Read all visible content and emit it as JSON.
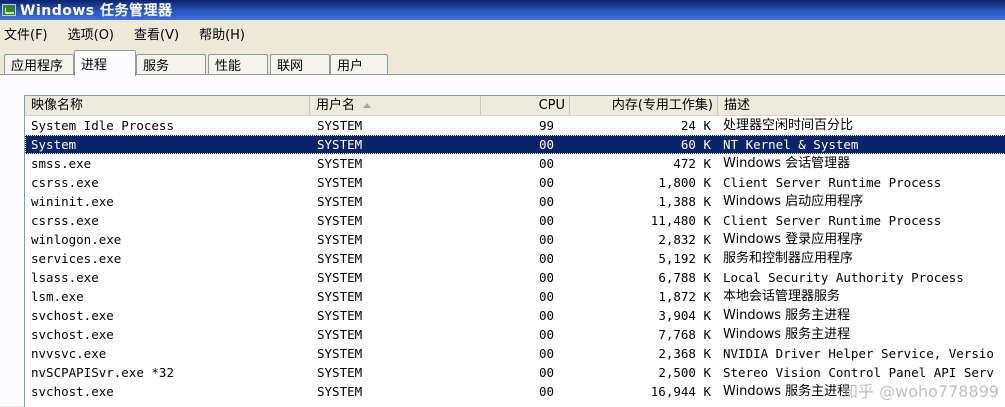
{
  "window": {
    "title": "Windows 任务管理器"
  },
  "menu": [
    "文件(F)",
    "选项(O)",
    "查看(V)",
    "帮助(H)"
  ],
  "tabs": [
    "应用程序",
    "进程",
    "服务",
    "性能",
    "联网",
    "用户"
  ],
  "active_tab": "进程",
  "columns": {
    "name": "映像名称",
    "user": "用户名",
    "cpu": "CPU",
    "mem": "内存(专用工作集)",
    "desc": "描述"
  },
  "rows": [
    {
      "name": "System Idle Process",
      "user": "SYSTEM",
      "cpu": "99",
      "mem": "24 K",
      "desc": "处理器空闲时间百分比"
    },
    {
      "name": "System",
      "user": "SYSTEM",
      "cpu": "00",
      "mem": "60 K",
      "desc": "NT Kernel & System",
      "selected": true
    },
    {
      "name": "smss.exe",
      "user": "SYSTEM",
      "cpu": "00",
      "mem": "472 K",
      "desc": "Windows 会话管理器"
    },
    {
      "name": "csrss.exe",
      "user": "SYSTEM",
      "cpu": "00",
      "mem": "1,800 K",
      "desc": "Client Server Runtime Process"
    },
    {
      "name": "wininit.exe",
      "user": "SYSTEM",
      "cpu": "00",
      "mem": "1,388 K",
      "desc": "Windows 启动应用程序"
    },
    {
      "name": "csrss.exe",
      "user": "SYSTEM",
      "cpu": "00",
      "mem": "11,480 K",
      "desc": "Client Server Runtime Process"
    },
    {
      "name": "winlogon.exe",
      "user": "SYSTEM",
      "cpu": "00",
      "mem": "2,832 K",
      "desc": "Windows 登录应用程序"
    },
    {
      "name": "services.exe",
      "user": "SYSTEM",
      "cpu": "00",
      "mem": "5,192 K",
      "desc": "服务和控制器应用程序"
    },
    {
      "name": "lsass.exe",
      "user": "SYSTEM",
      "cpu": "00",
      "mem": "6,788 K",
      "desc": "Local Security Authority Process"
    },
    {
      "name": "lsm.exe",
      "user": "SYSTEM",
      "cpu": "00",
      "mem": "1,872 K",
      "desc": "本地会话管理器服务"
    },
    {
      "name": "svchost.exe",
      "user": "SYSTEM",
      "cpu": "00",
      "mem": "3,904 K",
      "desc": "Windows 服务主进程"
    },
    {
      "name": "svchost.exe",
      "user": "SYSTEM",
      "cpu": "00",
      "mem": "7,768 K",
      "desc": "Windows 服务主进程"
    },
    {
      "name": "nvvsvc.exe",
      "user": "SYSTEM",
      "cpu": "00",
      "mem": "2,368 K",
      "desc": "NVIDIA Driver Helper Service, Versio"
    },
    {
      "name": "nvSCPAPISvr.exe *32",
      "user": "SYSTEM",
      "cpu": "00",
      "mem": "2,500 K",
      "desc": "Stereo Vision Control Panel API Serv"
    },
    {
      "name": "svchost.exe",
      "user": "SYSTEM",
      "cpu": "00",
      "mem": "16,944 K",
      "desc": "Windows 服务主进程"
    }
  ],
  "watermark": "知乎 @woho778899",
  "colors": {
    "selection": "#0a246a",
    "titlebar": "#0a246a",
    "face": "#ece9d8"
  }
}
